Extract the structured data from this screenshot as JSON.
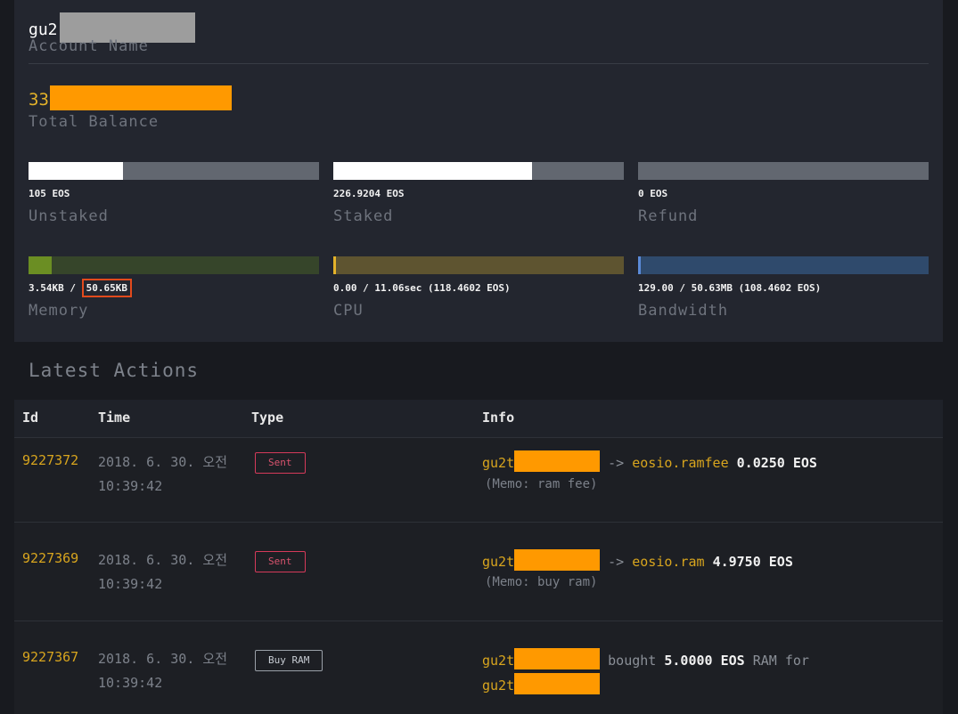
{
  "account": {
    "name_prefix": "gu2",
    "name_label": "Account Name",
    "balance_prefix": "33",
    "balance_label": "Total Balance"
  },
  "resources": {
    "unstaked": {
      "value": "105 EOS",
      "label": "Unstaked",
      "fill_fraction": 0.325
    },
    "staked": {
      "value": "226.9204 EOS",
      "label": "Staked",
      "fill_fraction": 0.684
    },
    "refund": {
      "value": "0 EOS",
      "label": "Refund",
      "fill_fraction": 0
    },
    "memory": {
      "used": "3.54KB",
      "sep": " / ",
      "total": "50.65KB",
      "label": "Memory",
      "fill_fraction": 0.08
    },
    "cpu": {
      "value": "0.00 / 11.06sec (118.4602 EOS)",
      "label": "CPU",
      "fill_fraction": 0.01
    },
    "bandwidth": {
      "value": "129.00 / 50.63MB (108.4602 EOS)",
      "label": "Bandwidth",
      "fill_fraction": 0.01
    }
  },
  "colors": {
    "unstaked_fill": "#ffffff",
    "unstaked_track": "#626770",
    "memory_fill": "#6b8e23",
    "memory_track": "#36452a",
    "cpu_fill": "#e3b22a",
    "cpu_track": "#5e5430",
    "bandwidth_fill": "#5b8ad8",
    "bandwidth_track": "#2f4a6c",
    "highlight_box": "#e24a1c"
  },
  "actions": {
    "title": "Latest Actions",
    "headers": {
      "id": "Id",
      "time": "Time",
      "type": "Type",
      "info": "Info"
    },
    "rows": [
      {
        "id": "9227372",
        "time": "2018. 6. 30. 오전 10:39:42",
        "type": "Sent",
        "from": "gu2t",
        "arrow": "->",
        "to": "eosio.ramfee",
        "amount": "0.0250 EOS",
        "memo": "(Memo: ram fee)"
      },
      {
        "id": "9227369",
        "time": "2018. 6. 30. 오전 10:39:42",
        "type": "Sent",
        "from": "gu2t",
        "arrow": "->",
        "to": "eosio.ram",
        "amount": "4.9750 EOS",
        "memo": "(Memo: buy ram)"
      },
      {
        "id": "9227367",
        "time": "2018. 6. 30. 오전 10:39:42",
        "type": "Buy RAM",
        "from": "gu2t",
        "verb": "bought",
        "amount": "5.0000 EOS",
        "ram_for": "RAM for",
        "receiver": "gu2t"
      }
    ]
  }
}
